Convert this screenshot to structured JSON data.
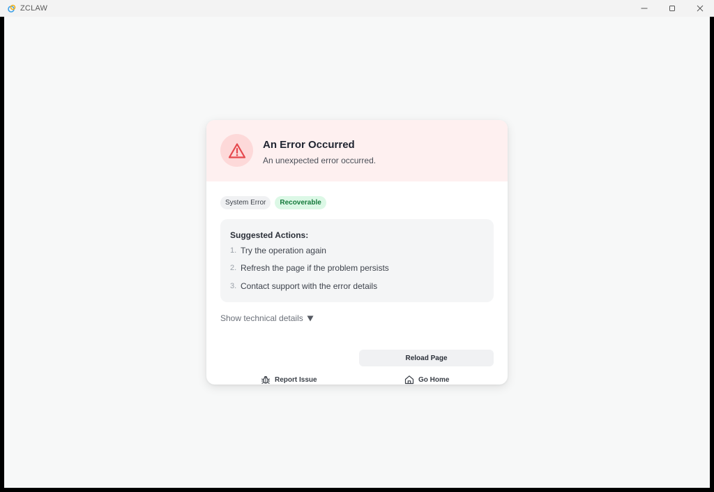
{
  "window": {
    "title": "ZCLAW",
    "controls": {
      "minimize_icon": "minimize-icon",
      "maximize_icon": "maximize-icon",
      "close_icon": "close-icon"
    }
  },
  "error_card": {
    "icon": "warning-triangle-icon",
    "title": "An Error Occurred",
    "message": "An unexpected error occurred.",
    "tags": [
      "System Error",
      "Recoverable"
    ],
    "suggested_actions": {
      "heading": "Suggested Actions:",
      "items": [
        {
          "number": "1.",
          "text": "Try the operation again"
        },
        {
          "number": "2.",
          "text": "Refresh the page if the problem persists"
        },
        {
          "number": "3.",
          "text": "Contact support with the error details"
        }
      ]
    },
    "technical_details_label": "Show technical details",
    "reload_label": "Reload Page",
    "report_label": "Report Issue",
    "home_label": "Go Home"
  },
  "colors": {
    "header_bg": "#fef0f0",
    "error_red": "#e5484d",
    "recoverable_bg": "#dcf8e6",
    "recoverable_text": "#157a3c"
  }
}
